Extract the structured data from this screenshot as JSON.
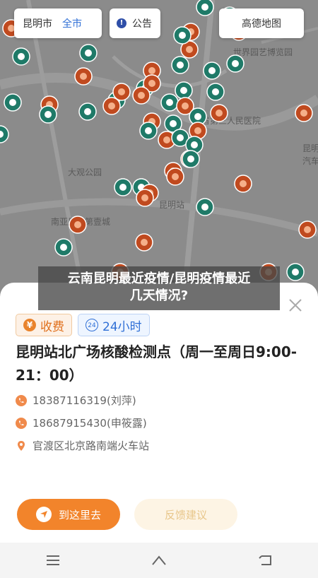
{
  "map": {
    "city_label": "昆明市",
    "scope_label": "全市",
    "notice_label": "公告",
    "notice_icon": "info-icon",
    "brand_label": "高德地图",
    "place_labels": [
      "世界园艺博览园",
      "省第三人民医院",
      "大观公园",
      "昆明站",
      "南亚风情第壹城",
      "昆明",
      "汽车"
    ],
    "marker_colors": {
      "free": "#1f7a68",
      "fee": "#c04a1f"
    }
  },
  "overlay": {
    "title_line1": "云南昆明最近疫情/昆明疫情最近",
    "title_line2": "几天情况?"
  },
  "sheet": {
    "fee_icon": "yen-icon",
    "fee_label": "收费",
    "hours_icon": "24h-icon",
    "hours_label": "24小时",
    "site_name": "昆明站北广场核酸检测点（周一至周日9:00-21：00）",
    "phone1": "18387116319(刘萍)",
    "phone2": "18687915430(申筱露)",
    "address": "官渡区北京路南端火车站",
    "go_label": "到这里去",
    "feedback_label": "反馈建议"
  },
  "colors": {
    "accent": "#f2842b",
    "blue": "#2f6fd6"
  }
}
